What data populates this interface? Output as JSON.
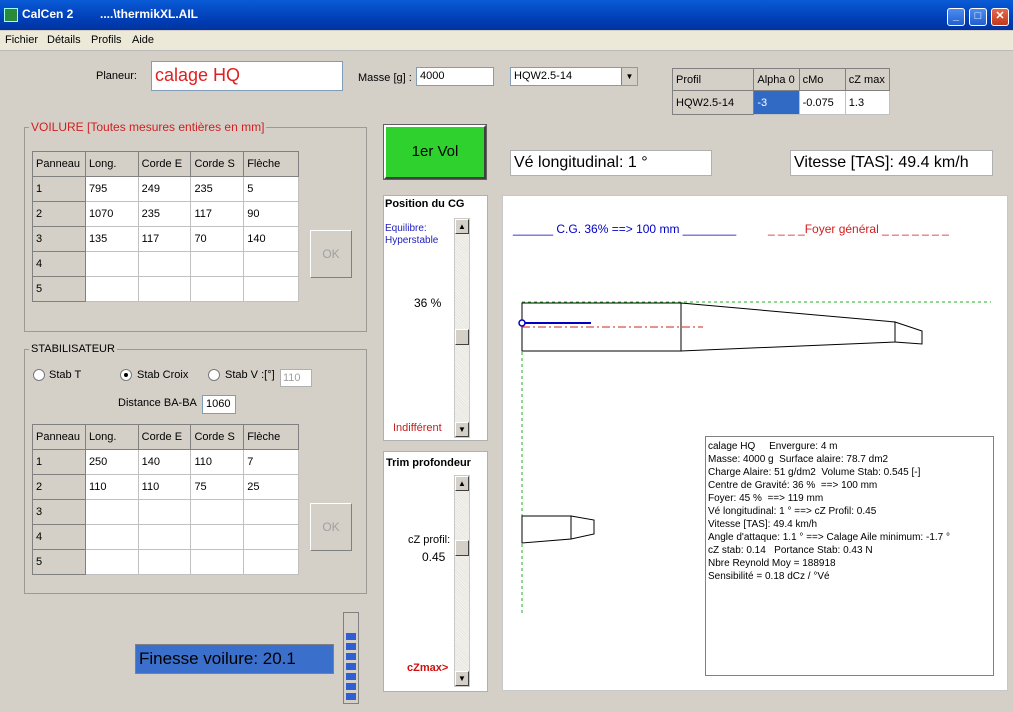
{
  "window": {
    "app_name": "CalCen 2",
    "file": "....\\thermikXL.AIL",
    "minimize": "_",
    "maximize": "□",
    "close": "✕"
  },
  "menu": [
    "Fichier",
    "Détails",
    "Profils",
    "Aide"
  ],
  "planeur": {
    "label": "Planeur:",
    "value": "calage HQ"
  },
  "masse": {
    "label": "Masse [g] :",
    "value": "4000"
  },
  "profile_select": {
    "value": "HQW2.5-14"
  },
  "profile_table": {
    "headers": [
      "Profil",
      "Alpha 0",
      "cMo",
      "cZ max"
    ],
    "row": [
      "HQW2.5-14",
      "-3",
      "-0.075",
      "1.3"
    ]
  },
  "voilure": {
    "title": "VOILURE  [Toutes mesures entières en mm]",
    "headers": [
      "Panneau",
      "Long.",
      "Corde E",
      "Corde S",
      "Flèche"
    ],
    "rows": [
      [
        "1",
        "795",
        "249",
        "235",
        "5"
      ],
      [
        "2",
        "1070",
        "235",
        "117",
        "90"
      ],
      [
        "3",
        "135",
        "117",
        "70",
        "140"
      ],
      [
        "4",
        "",
        "",
        "",
        ""
      ],
      [
        "5",
        "",
        "",
        "",
        ""
      ]
    ],
    "ok": "OK"
  },
  "stab": {
    "title": "STABILISATEUR",
    "radios": [
      "Stab T",
      "Stab Croix",
      "Stab V :[°]"
    ],
    "selected": 1,
    "stabv_value": "110",
    "distance_label": "Distance BA-BA",
    "distance_value": "1060",
    "headers": [
      "Panneau",
      "Long.",
      "Corde E",
      "Corde S",
      "Flèche"
    ],
    "rows": [
      [
        "1",
        "250",
        "140",
        "110",
        "7"
      ],
      [
        "2",
        "110",
        "110",
        "75",
        "25"
      ],
      [
        "3",
        "",
        "",
        "",
        ""
      ],
      [
        "4",
        "",
        "",
        "",
        ""
      ],
      [
        "5",
        "",
        "",
        "",
        ""
      ]
    ],
    "ok": "OK"
  },
  "finesse": "Finesse voilure: 20.1",
  "first_flight": "1er Vol",
  "ve_long": "Vé longitudinal: 1 °",
  "vitesse": "Vitesse [TAS]: 49.4 km/h",
  "cg_panel": {
    "title": "Position du CG",
    "top_label": "Equilibre: Hyperstable",
    "value": "36 %",
    "bottom_label": "Indifférent"
  },
  "trim_panel": {
    "title": "Trim profondeur",
    "label": "cZ profil:",
    "value": "0.45",
    "bottom_label": "cZmax>"
  },
  "drawing": {
    "cg_legend": "______ C.G. 36% ==> 100 mm ________",
    "foyer_legend": "_ _ _ _Foyer général _ _ _ _ _ _ _"
  },
  "info": {
    "lines": [
      "calage HQ     Envergure: 4 m",
      "",
      "Masse: 4000 g  Surface alaire: 78.7 dm2",
      "Charge Alaire: 51 g/dm2  Volume Stab: 0.545 [-]",
      "",
      "Centre de Gravité: 36 %  ==> 100 mm",
      "Foyer: 45 %  ==> 119 mm",
      "",
      "Vé longitudinal: 1 ° ==> cZ Profil: 0.45",
      "Vitesse [TAS]: 49.4 km/h",
      "",
      "Angle d'attaque: 1.1 ° ==> Calage Aile minimum: -1.7 °",
      "",
      "cZ stab: 0.14   Portance Stab: 0.43 N",
      "Nbre Reynold Moy = 188918",
      "Sensibilité = 0.18 dCz / °Vé"
    ]
  },
  "colors": {
    "green_button": "#2ed12e",
    "selected_cell": "#316ac5",
    "finesse_bg": "#3a6fcb",
    "cg_blue": "#0000c8",
    "foyer_red": "#d02020"
  }
}
